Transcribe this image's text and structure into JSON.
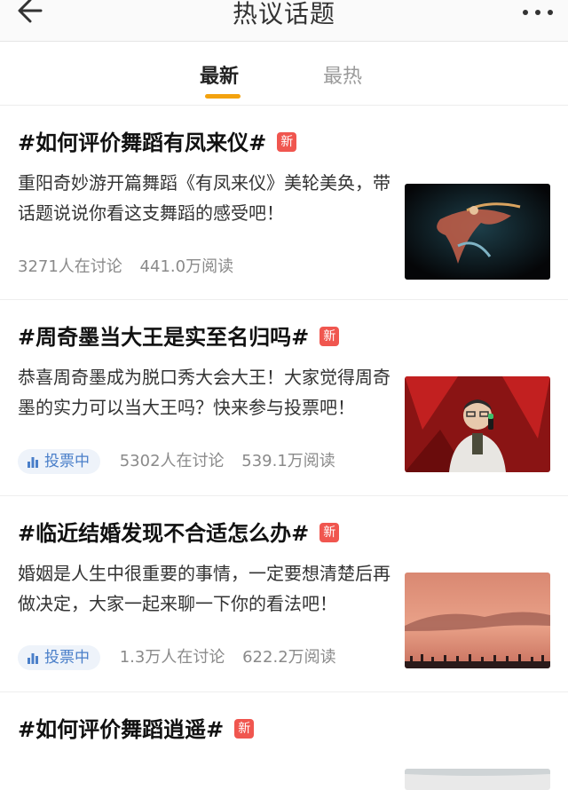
{
  "header": {
    "title": "热议话题",
    "back_icon": "back-arrow-icon",
    "more_icon": "more-dots-icon"
  },
  "tabs": [
    {
      "label": "最新",
      "active": true
    },
    {
      "label": "最热",
      "active": false
    }
  ],
  "colors": {
    "accent": "#f3a20e",
    "badge": "#f0564f",
    "vote": "#4a7fc9"
  },
  "topics": [
    {
      "title": "#如何评价舞蹈有凤来仪#",
      "badge": "新",
      "description": "重阳奇妙游开篇舞蹈《有凤来仪》美轮美奂，带话题说说你看这支舞蹈的感受吧！",
      "vote": null,
      "discussions": "3271人在讨论",
      "reads": "441.0万阅读"
    },
    {
      "title": "#周奇墨当大王是实至名归吗#",
      "badge": "新",
      "description": "恭喜周奇墨成为脱口秀大会大王！大家觉得周奇墨的实力可以当大王吗？快来参与投票吧！",
      "vote": "投票中",
      "discussions": "5302人在讨论",
      "reads": "539.1万阅读"
    },
    {
      "title": "#临近结婚发现不合适怎么办#",
      "badge": "新",
      "description": "婚姻是人生中很重要的事情，一定要想清楚后再做决定，大家一起来聊一下你的看法吧！",
      "vote": "投票中",
      "discussions": "1.3万人在讨论",
      "reads": "622.2万阅读"
    },
    {
      "title": "#如何评价舞蹈逍遥#",
      "badge": "新",
      "description": "",
      "vote": null,
      "discussions": "",
      "reads": ""
    }
  ]
}
